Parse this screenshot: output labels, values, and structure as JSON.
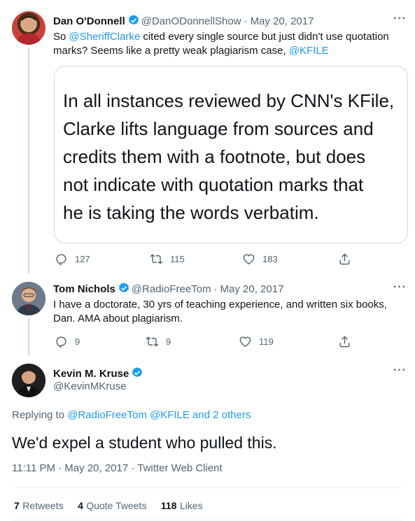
{
  "tweet1": {
    "name": "Dan O'Donnell",
    "handle": "@DanODonnellShow",
    "date": "May 20, 2017",
    "text_a": "So ",
    "mention_a": "@SheriffClarke",
    "text_b": " cited every single source but just didn't use quotation marks? Seems like a pretty weak plagiarism case, ",
    "mention_b": "@KFILE",
    "card_lines": [
      "In all instances reviewed by CNN's KFile,",
      "Clarke lifts language from sources and",
      "credits them with a footnote, but does",
      "not indicate with quotation marks that",
      "he is taking the words verbatim."
    ],
    "replies": "127",
    "retweets": "115",
    "likes": "183"
  },
  "tweet2": {
    "name": "Tom Nichols",
    "handle": "@RadioFreeTom",
    "date": "May 20, 2017",
    "text": "I have a doctorate, 30 yrs of teaching experience, and written six books, Dan. AMA about plagiarism.",
    "replies": "9",
    "retweets": "9",
    "likes": "119"
  },
  "main_tweet": {
    "name": "Kevin M. Kruse",
    "handle": "@KevinMKruse",
    "replying_prefix": "Replying to ",
    "replying_mentions": "@RadioFreeTom @KFILE and 2 others",
    "text": "We'd expel a student who pulled this.",
    "timestamp": "11:11 PM · May 20, 2017 · Twitter Web Client",
    "retweets_count": "7",
    "retweets_label": "Retweets",
    "quotes_count": "4",
    "quotes_label": "Quote Tweets",
    "likes_count": "118",
    "likes_label": "Likes"
  },
  "more_symbol": "···",
  "separator_dot": "·",
  "colors": {
    "accent": "#1d9bf0",
    "text_secondary": "#536471",
    "border": "#cfd9de"
  }
}
